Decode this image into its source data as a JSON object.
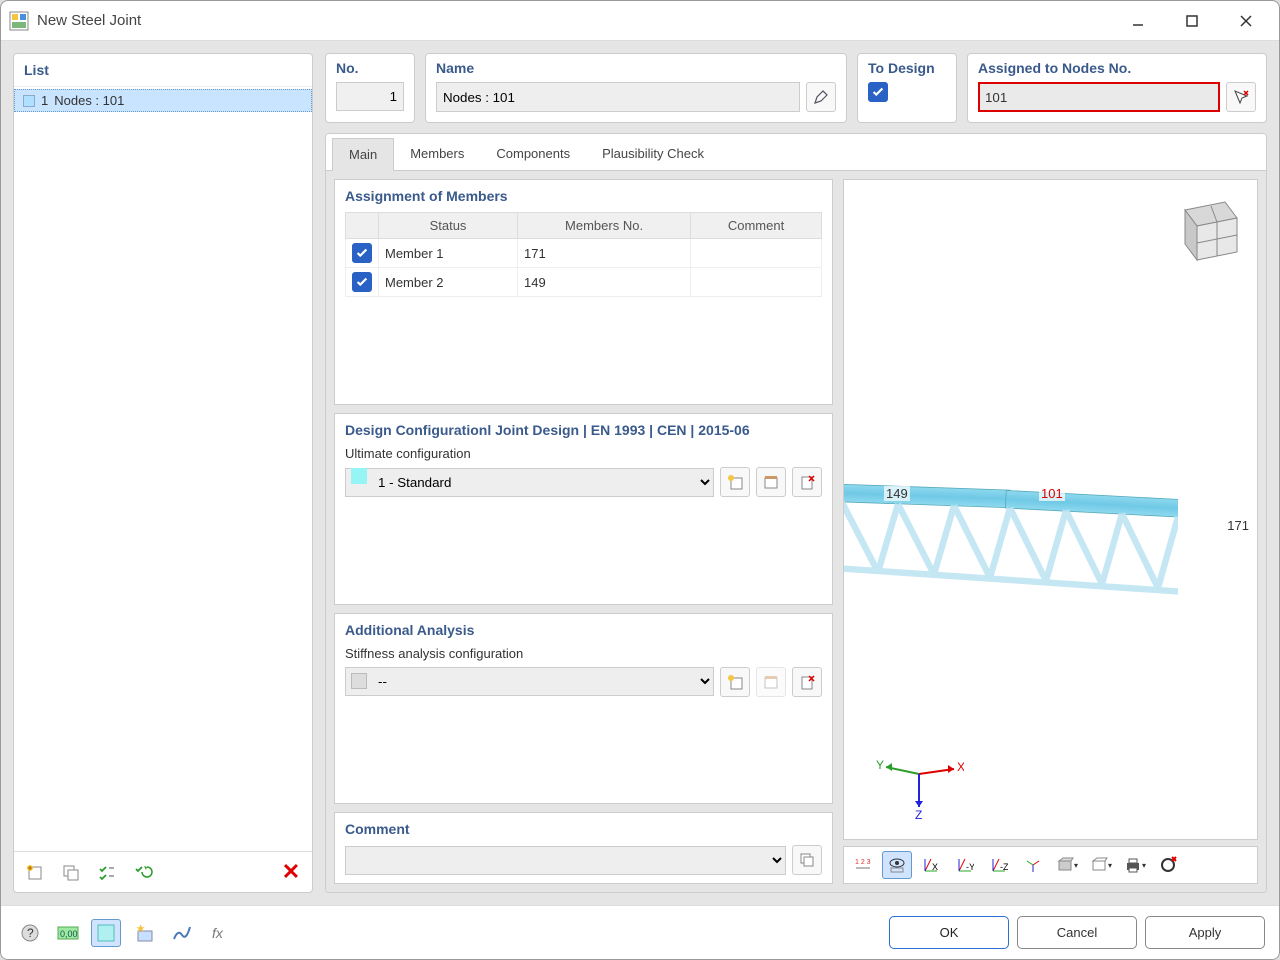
{
  "window": {
    "title": "New Steel Joint"
  },
  "list": {
    "title": "List",
    "items": [
      {
        "index": "1",
        "label": "Nodes : 101"
      }
    ]
  },
  "header": {
    "no_label": "No.",
    "no_value": "1",
    "name_label": "Name",
    "name_value": "Nodes : 101",
    "todesign_label": "To Design",
    "assigned_label": "Assigned to Nodes No.",
    "assigned_value": "101"
  },
  "tabs": {
    "main": "Main",
    "members": "Members",
    "components": "Components",
    "plausibility": "Plausibility Check"
  },
  "assignment": {
    "title": "Assignment of Members",
    "columns": {
      "status": "Status",
      "members_no": "Members No.",
      "comment": "Comment"
    },
    "rows": [
      {
        "checked": true,
        "status": "Member 1",
        "members_no": "171",
        "comment": ""
      },
      {
        "checked": true,
        "status": "Member 2",
        "members_no": "149",
        "comment": ""
      }
    ]
  },
  "design_config": {
    "title": "Design Configurationl Joint Design | EN 1993 | CEN | 2015-06",
    "ultimate_label": "Ultimate configuration",
    "ultimate_value": "1 - Standard"
  },
  "additional": {
    "title": "Additional Analysis",
    "stiffness_label": "Stiffness analysis configuration",
    "stiffness_value": "--"
  },
  "comment": {
    "title": "Comment",
    "value": ""
  },
  "viewport": {
    "label_149": "149",
    "label_101": "101",
    "label_171": "171",
    "axis_x": "X",
    "axis_y": "Y",
    "axis_z": "Z"
  },
  "footer": {
    "ok": "OK",
    "cancel": "Cancel",
    "apply": "Apply"
  }
}
